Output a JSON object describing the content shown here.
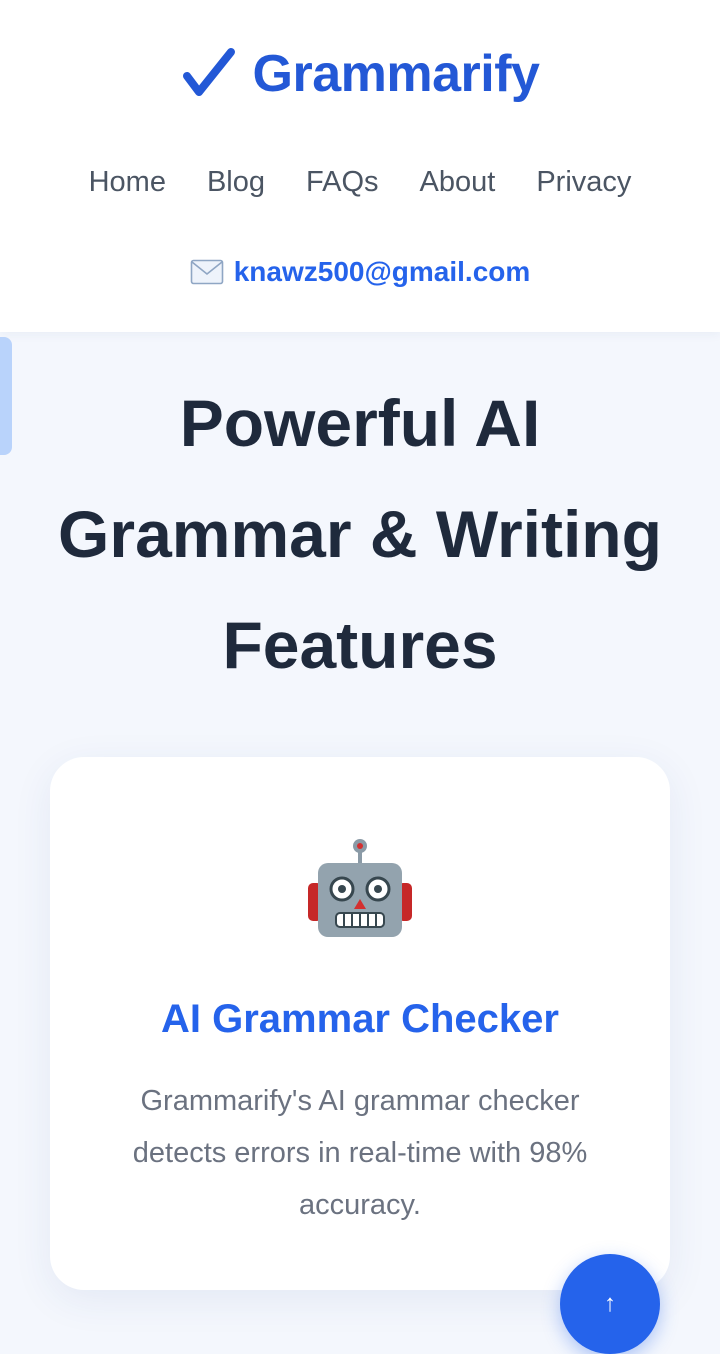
{
  "brand": {
    "name": "Grammarify",
    "icon": "check-icon",
    "color": "#2358d6"
  },
  "nav": {
    "items": [
      {
        "label": "Home"
      },
      {
        "label": "Blog"
      },
      {
        "label": "FAQs"
      },
      {
        "label": "About"
      },
      {
        "label": "Privacy"
      }
    ]
  },
  "contact": {
    "icon": "mail-icon",
    "email": "knawz500@gmail.com"
  },
  "hero": {
    "title": "Powerful AI Grammar & Writing Features"
  },
  "feature_card": {
    "icon": "robot-icon",
    "title": "AI Grammar Checker",
    "description": "Grammarify's AI grammar checker detects errors in real-time with 98% accuracy."
  },
  "scroll_top": {
    "label": "↑",
    "icon": "arrow-up-icon"
  },
  "colors": {
    "accent": "#2563eb",
    "heading": "#1f2a3c",
    "body_text": "#6b7280",
    "page_bg": "#f4f7fd"
  }
}
